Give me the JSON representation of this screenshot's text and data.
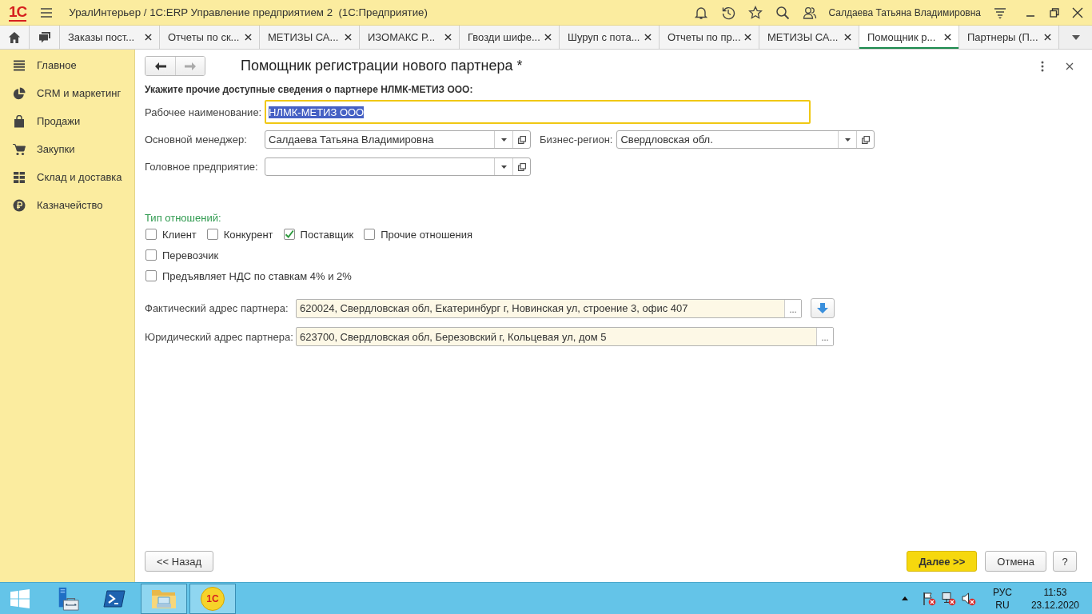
{
  "app_bar": {
    "logo": "1С",
    "title": "УралИнтерьер / 1С:ERP Управление предприятием 2  (1С:Предприятие)",
    "user": "Салдаева Татьяна Владимировна"
  },
  "tabs": [
    {
      "label": "Заказы пост...",
      "selected": false
    },
    {
      "label": "Отчеты по ск...",
      "selected": false
    },
    {
      "label": "МЕТИЗЫ СА...",
      "selected": false
    },
    {
      "label": "ИЗОМАКС Р...",
      "selected": false
    },
    {
      "label": "Гвозди шифе...",
      "selected": false
    },
    {
      "label": "Шуруп с пота...",
      "selected": false
    },
    {
      "label": "Отчеты по пр...",
      "selected": false
    },
    {
      "label": "МЕТИЗЫ СА...",
      "selected": false
    },
    {
      "label": "Помощник р...",
      "selected": true
    },
    {
      "label": "Партнеры (П...",
      "selected": false
    }
  ],
  "sidebar": {
    "items": [
      {
        "label": "Главное"
      },
      {
        "label": "CRM и маркетинг"
      },
      {
        "label": "Продажи"
      },
      {
        "label": "Закупки"
      },
      {
        "label": "Склад и доставка"
      },
      {
        "label": "Казначейство"
      }
    ]
  },
  "form": {
    "nav_buttons": [
      {
        "disabled": false
      },
      {
        "disabled": true
      }
    ],
    "title": "Помощник регистрации нового партнера *",
    "instruction": "Укажите прочие доступные сведения о партнере НЛМК-МЕТИЗ ООО:",
    "name_field": {
      "label": "Рабочее наименование:",
      "value": "НЛМК-МЕТИЗ ООО",
      "focused": true,
      "text_selected": true
    },
    "rows": [
      {
        "fields": [
          {
            "label": "Основной менеджер:",
            "value": "Салдаева Татьяна Владимировна"
          },
          {
            "label": "Бизнес-регион:",
            "value": "Свердловская обл."
          }
        ]
      },
      {
        "fields": [
          {
            "label": "Головное предприятие:"
          }
        ]
      }
    ],
    "relations": {
      "label": "Тип отношений:",
      "option_rows": [
        {
          "options": [
            {
              "label": "Клиент",
              "checked": false
            },
            {
              "label": "Конкурент",
              "checked": false
            },
            {
              "label": "Поставщик",
              "checked": true
            },
            {
              "label": "Прочие отношения",
              "checked": false
            }
          ]
        },
        {
          "options": [
            {
              "label": "Перевозчик",
              "checked": false
            }
          ]
        },
        {
          "options": [
            {
              "label": "Предъявляет НДС по ставкам 4% и 2%",
              "checked": false
            }
          ]
        }
      ]
    },
    "addresses": [
      {
        "label": "Фактический адрес партнера:",
        "value": "620024, Свердловская обл, Екатеринбург г, Новинская ул, строение 3, офис 407",
        "select_button": "...",
        "fill_button": true
      },
      {
        "label": "Юридический адрес партнера:",
        "value": "623700, Свердловская обл, Березовский г, Кольцевая ул, дом 5",
        "select_button": "...",
        "fill_button": false
      }
    ],
    "footer": {
      "left": [
        {
          "label": "<< Назад",
          "primary": false
        }
      ],
      "right": [
        {
          "label": "Далее >>",
          "primary": true
        },
        {
          "label": "Отмена",
          "primary": false
        },
        {
          "label": "?",
          "primary": false
        }
      ]
    }
  },
  "taskbar": {
    "apps": [
      {
        "running": false
      },
      {
        "running": false
      },
      {
        "running": true
      },
      {
        "running": true,
        "label": "1С"
      }
    ],
    "tray": {
      "language": "РУС",
      "locale": "RU",
      "time": "11:53",
      "date": "23.12.2020"
    }
  }
}
